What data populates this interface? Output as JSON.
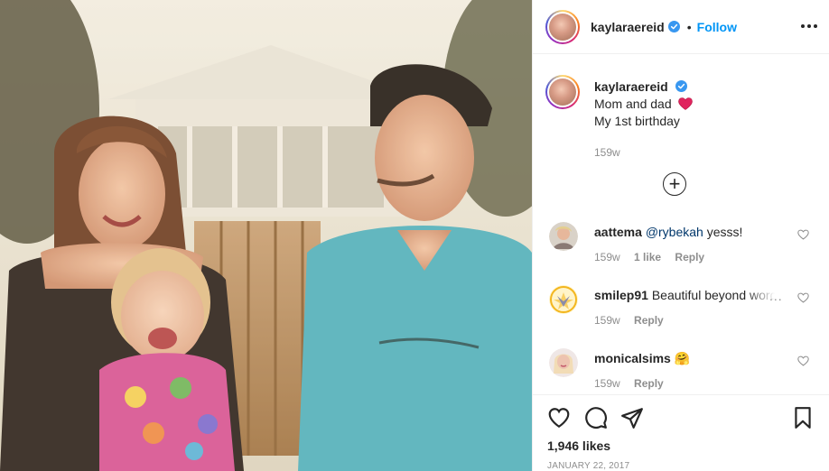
{
  "post": {
    "author": "kaylaraereid",
    "follow_label": "Follow",
    "separator": "•",
    "caption_lines": [
      "Mom and dad",
      "My 1st birthday"
    ],
    "caption_time": "159w",
    "likes": "1,946 likes",
    "date": "JANUARY 22, 2017"
  },
  "comments": [
    {
      "user": "aattema",
      "mention": "@rybekah",
      "text": " yesss!",
      "time": "159w",
      "likes": "1 like",
      "reply": "Reply"
    },
    {
      "user": "smilep91",
      "mention": "",
      "text": " Beautiful beyond words",
      "time": "159w",
      "likes": "",
      "reply": "Reply"
    },
    {
      "user": "monicalsims",
      "mention": "",
      "text": " 🤗",
      "time": "159w",
      "likes": "",
      "reply": "Reply"
    }
  ],
  "icons": {
    "heart_emoji": "red-heart-emoji",
    "verified": "verified-badge-icon",
    "more": "more-options-icon",
    "load_more": "plus-circle-icon",
    "like": "heart-outline-icon",
    "comment": "comment-icon",
    "share": "send-icon",
    "save": "bookmark-icon"
  },
  "colors": {
    "link": "#0095f6",
    "verified": "#3897f0",
    "text": "#262626",
    "muted": "#8e8e8e",
    "divider": "#efefef"
  }
}
